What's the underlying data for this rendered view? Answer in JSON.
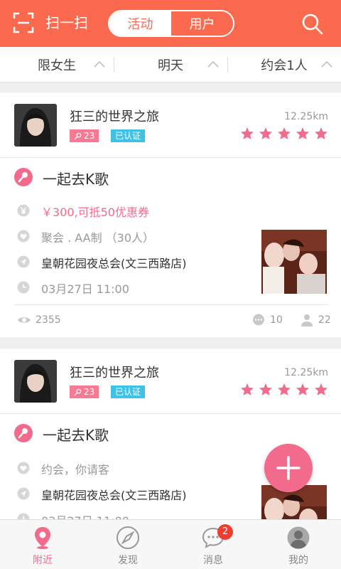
{
  "header": {
    "scan_label": "扫一扫",
    "tabs": [
      "活动",
      "用户"
    ],
    "active_tab": "活动",
    "accent": "#fb6a4e"
  },
  "filters": [
    {
      "label": "限女生"
    },
    {
      "label": "明天"
    },
    {
      "label": "约会1人"
    }
  ],
  "cards": [
    {
      "user": {
        "name": "狂三的世界之旅",
        "distance": "12.25km",
        "level": "23",
        "verified": "已认证",
        "rating": 5
      },
      "activity_title": "一起去K歌",
      "price": "￥300,可抵50优惠券",
      "type": "聚会 . AA制 （30人）",
      "location": "皇朝花园夜总会(文三西路店)",
      "time": "03月27日  11:00",
      "views": "2355",
      "comments": "10",
      "participants": "22"
    },
    {
      "user": {
        "name": "狂三的世界之旅",
        "distance": "12.25km",
        "level": "23",
        "verified": "已认证",
        "rating": 5
      },
      "activity_title": "一起去K歌",
      "type": "约会，你请客",
      "location": "皇朝花园夜总会(文三西路店)",
      "time": "03月27日  11:00"
    }
  ],
  "tabbar": [
    {
      "label": "附近",
      "icon": "location-pin-icon"
    },
    {
      "label": "发现",
      "icon": "compass-icon"
    },
    {
      "label": "消息",
      "icon": "chat-bubble-icon",
      "badge": "2"
    },
    {
      "label": "我的",
      "icon": "user-avatar-icon"
    }
  ],
  "colors": {
    "pink": "#f26b8d",
    "blue": "#3fc2e8",
    "badge_red": "#ee3c2e"
  }
}
